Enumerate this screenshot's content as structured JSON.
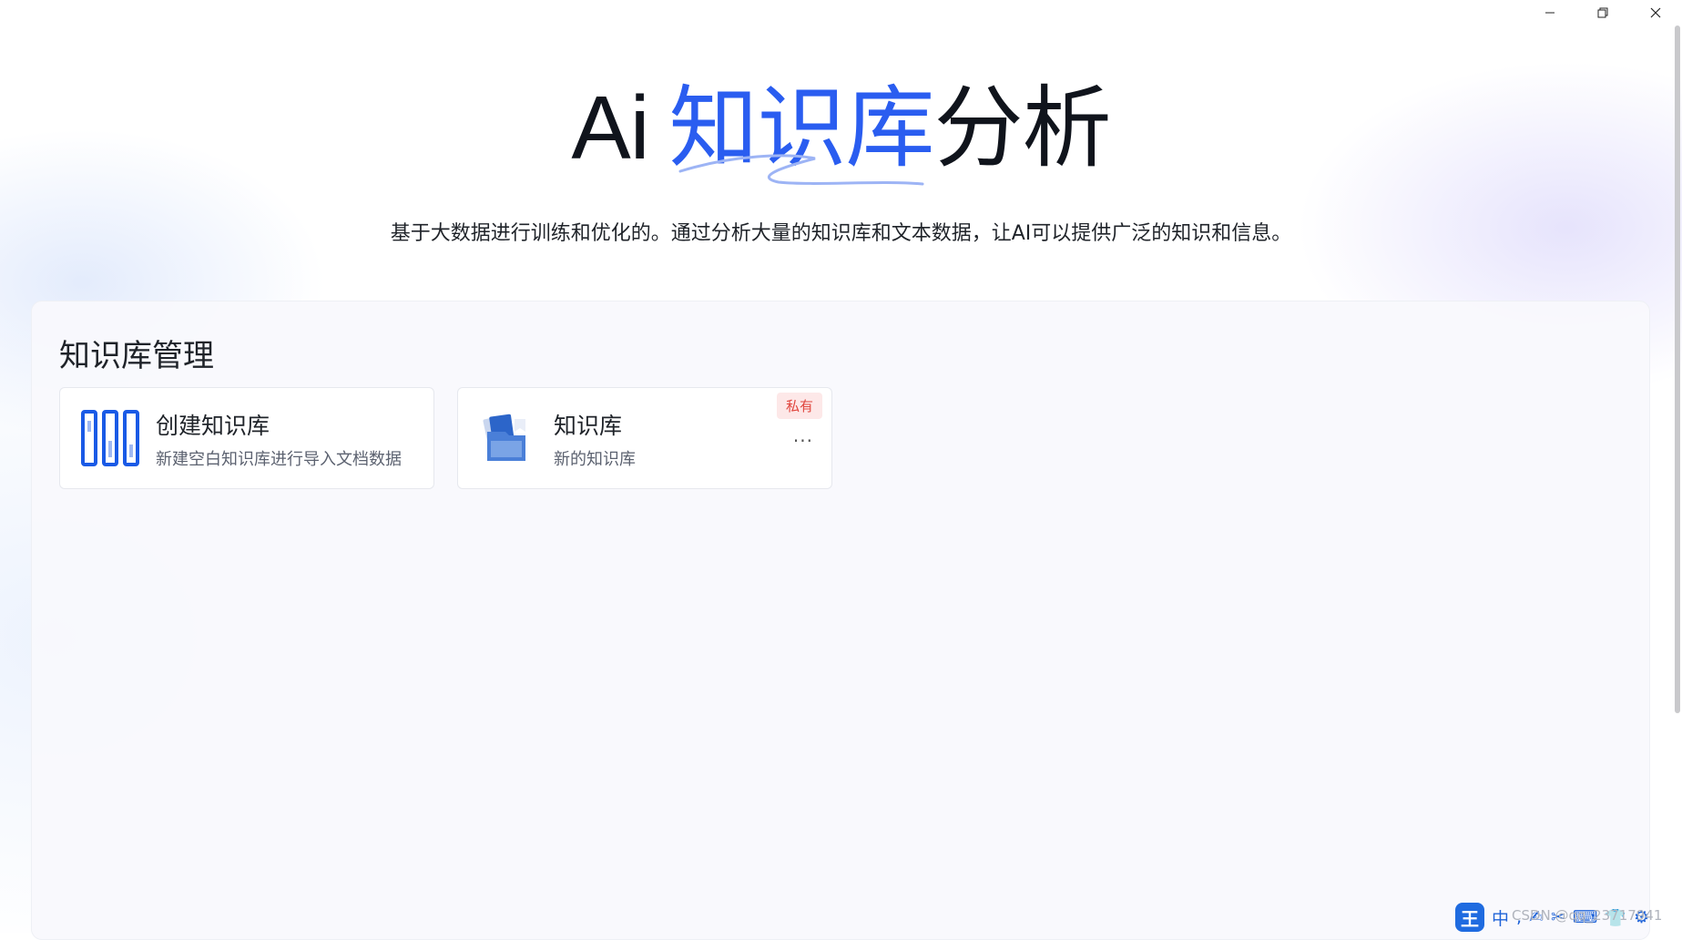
{
  "window": {
    "minimize_icon": "minimize-icon",
    "maximize_icon": "restore-icon",
    "close_icon": "close-icon"
  },
  "hero": {
    "title_prefix": "Ai",
    "title_accent": "知识库",
    "title_suffix": "分析",
    "subtitle": "基于大数据进行训练和优化的。通过分析大量的知识库和文本数据，让AI可以提供广泛的知识和信息。"
  },
  "colors": {
    "accent": "#2a5df0",
    "badge_text": "#e0463e",
    "badge_bg": "#fde8e8"
  },
  "section": {
    "title": "知识库管理"
  },
  "cards": [
    {
      "title": "创建知识库",
      "description": "新建空白知识库进行导入文档数据",
      "icon": "library-columns-icon"
    },
    {
      "title": "知识库",
      "description": "新的知识库",
      "badge": "私有",
      "more": "...",
      "icon": "folder-documents-icon"
    }
  ],
  "taskbar": {
    "ime_logo": "王",
    "ime_mode": "中",
    "ime_items": [
      ",",
      "✍",
      "✂",
      "⌨",
      "👕",
      "⚙"
    ],
    "watermark": "CSDN @qq_23717941"
  }
}
